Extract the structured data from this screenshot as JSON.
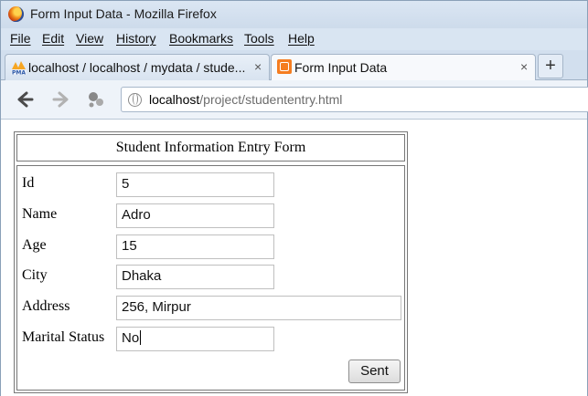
{
  "window": {
    "title": "Form Input Data - Mozilla Firefox"
  },
  "menu": [
    "File",
    "Edit",
    "View",
    "History",
    "Bookmarks",
    "Tools",
    "Help"
  ],
  "tabs": [
    {
      "label": "localhost / localhost / mydata / stude...",
      "icon": "phpmyadmin-icon",
      "close": "×"
    },
    {
      "label": "Form Input Data",
      "icon": "xampp-icon",
      "close": "×"
    }
  ],
  "new_tab": "+",
  "urlbar": {
    "host": "localhost",
    "path": "/project/studententry.html"
  },
  "form": {
    "title": "Student Information Entry Form",
    "fields": [
      {
        "label": "Id",
        "value": "5"
      },
      {
        "label": "Name",
        "value": "Adro"
      },
      {
        "label": "Age",
        "value": "15"
      },
      {
        "label": "City",
        "value": "Dhaka"
      },
      {
        "label": "Address",
        "value": "256, Mirpur"
      },
      {
        "label": "Marital Status",
        "value": "No"
      }
    ],
    "submit_label": "Sent"
  }
}
